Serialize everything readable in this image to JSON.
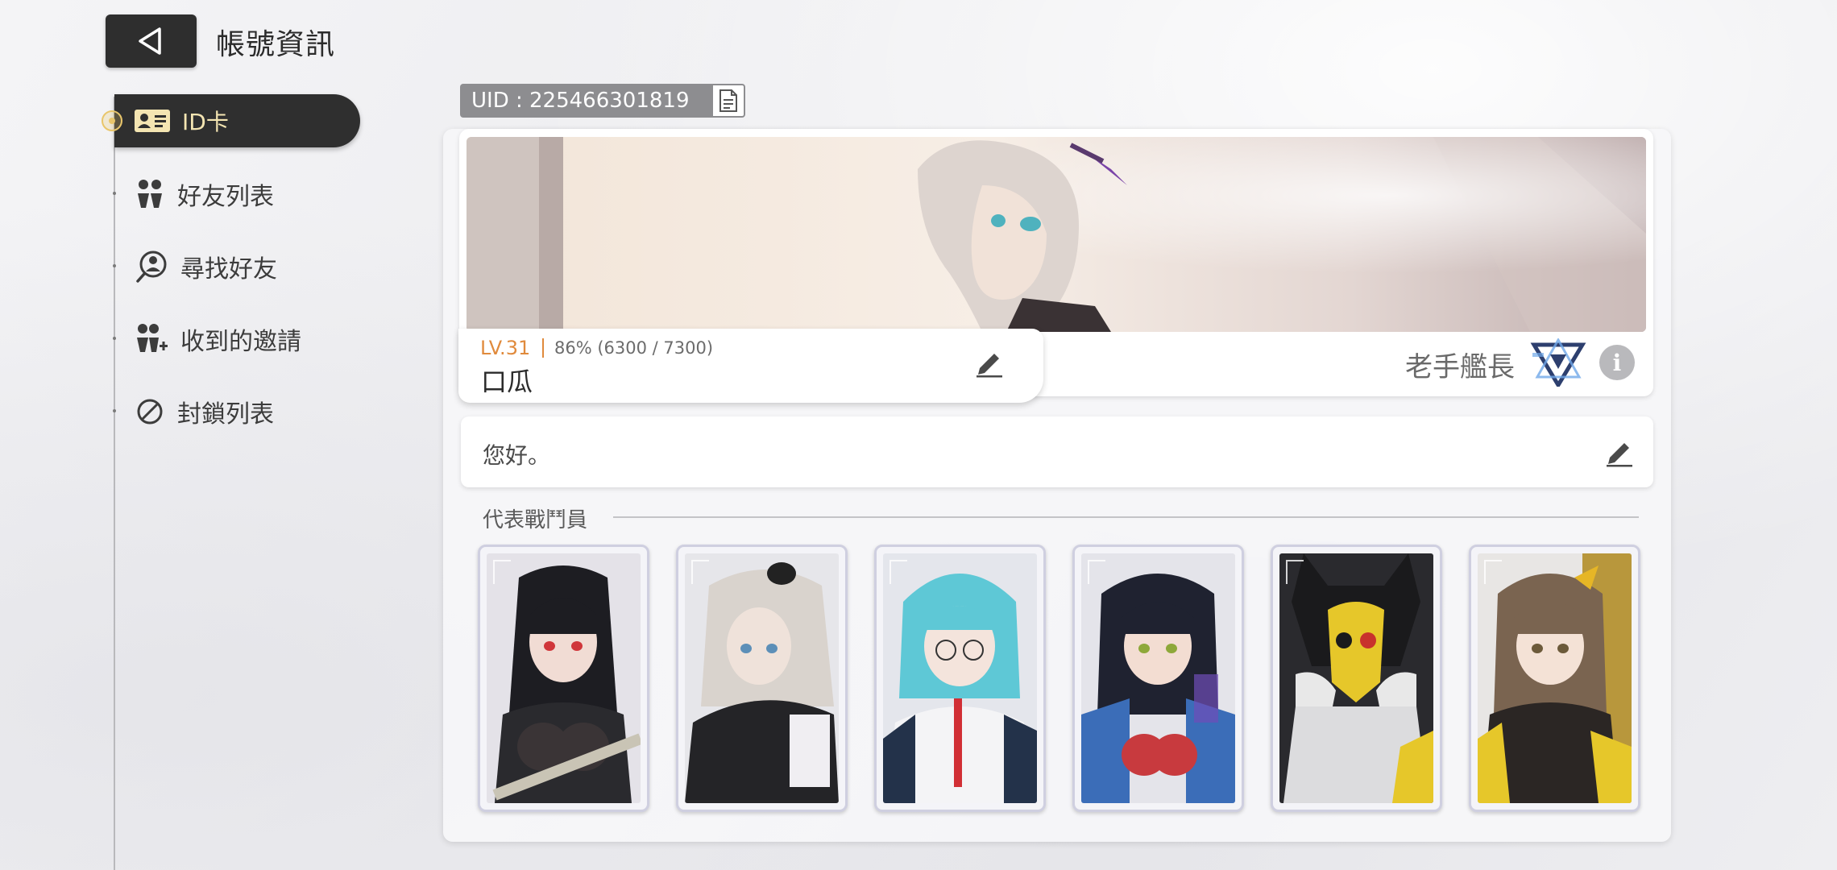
{
  "header": {
    "back_icon": "chevron-left-icon",
    "title": "帳號資訊"
  },
  "sidebar": {
    "items": [
      {
        "label": "ID卡",
        "icon": "id-card-icon",
        "active": true
      },
      {
        "label": "好友列表",
        "icon": "friends-icon",
        "active": false
      },
      {
        "label": "尋找好友",
        "icon": "search-friend-icon",
        "active": false
      },
      {
        "label": "收到的邀請",
        "icon": "add-friend-icon",
        "active": false
      },
      {
        "label": "封鎖列表",
        "icon": "block-icon",
        "active": false
      }
    ]
  },
  "profile": {
    "uid": "UID : 225466301819",
    "level": "LV.31",
    "exp": "86% (6300 / 7300)",
    "exp_percent": 86,
    "name": "口瓜",
    "rank_title": "老手艦長",
    "greeting": "您好。"
  },
  "fighters": {
    "section_title": "代表戰鬥員",
    "count": 6
  },
  "colors": {
    "accent_gold": "#e9c66b",
    "level_orange": "#e08a3c",
    "dark_button": "#2e2e2e"
  }
}
